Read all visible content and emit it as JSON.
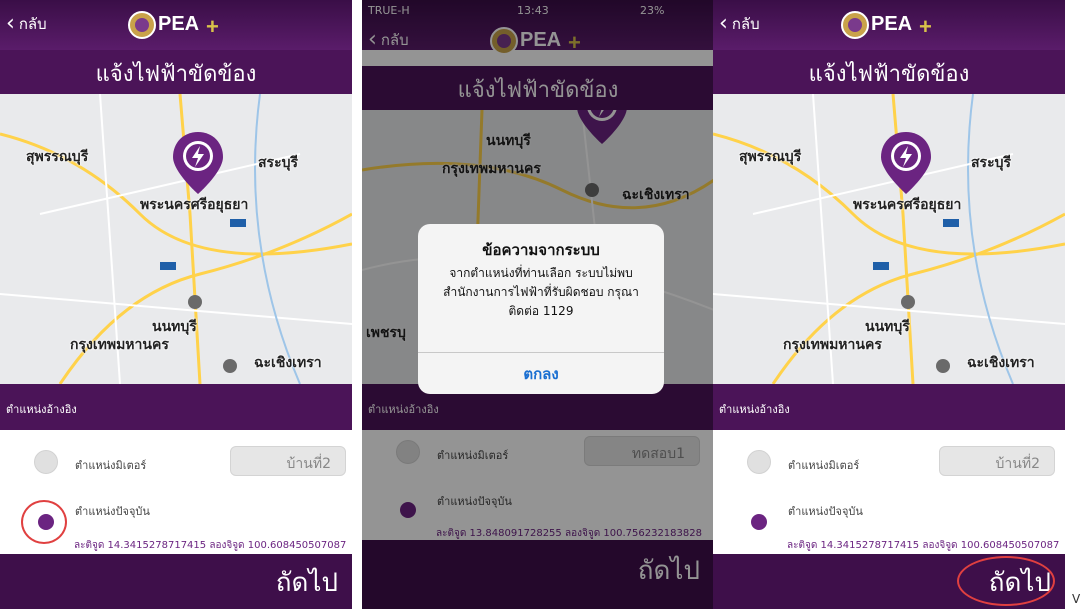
{
  "common": {
    "back_label": "กลับ",
    "title": "แจ้งไฟฟ้าขัดข้อง",
    "ref_label": "ตำแหน่งอ้างอิง",
    "meter_label": "ตำแหน่งมิเตอร์",
    "current_label": "ตำแหน่งปัจจุบัน",
    "next_label": "ถัดไป",
    "brand_colors": {
      "header": "#4b1458",
      "footer": "#3e0f4a",
      "accent": "#6b2481",
      "highlight_circle": "#e04040"
    }
  },
  "map_labels": {
    "suphanburi": "สุพรรณบุรี",
    "saraburi": "สระบุรี",
    "ayutthaya": "พระนครศรีอยุธยา",
    "nonthaburi": "นนทบุรี",
    "bangkok": "กรุงเทพมหานคร",
    "chachoengsao": "ฉะเชิงเทรา",
    "phetburi": "เพชรบุ"
  },
  "panel1": {
    "meter_value": "บ้านที่2",
    "coords": "ละติจูด 14.3415278717415   ลองจิจูด 100.608450507087"
  },
  "panel2": {
    "status": {
      "carrier": "TRUE-H",
      "time": "13:43",
      "battery": "23%"
    },
    "meter_value": "ทดสอบ1",
    "coords": "ละติจูด 13.848091728255   ลองจิจูด 100.756232183828",
    "dialog": {
      "title": "ข้อความจากระบบ",
      "message": "จากตำแหน่งที่ท่านเลือก ระบบไม่พบสำนักงานการไฟฟ้าที่รับผิดชอบ กรุณาติดต่อ 1129",
      "ok_label": "ตกลง"
    }
  },
  "panel3": {
    "meter_value": "บ้านที่2",
    "coords": "ละติจูด 14.3415278717415   ลองจิจูด 100.608450507087"
  },
  "trailing_glyph": "V"
}
